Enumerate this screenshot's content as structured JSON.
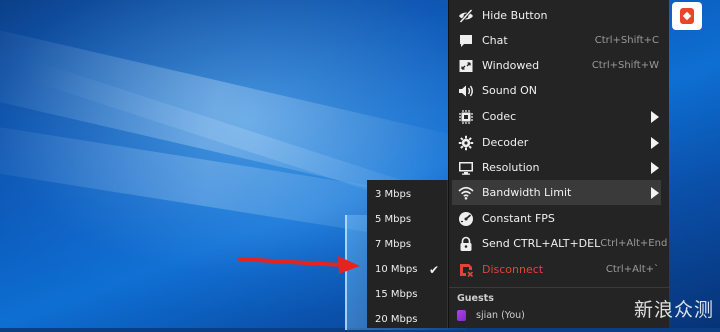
{
  "menu": {
    "items": [
      {
        "label": "Hide Button",
        "shortcut": "",
        "icon": "eye-slash-icon",
        "has_submenu": false
      },
      {
        "label": "Chat",
        "shortcut": "Ctrl+Shift+C",
        "icon": "chat-bubble-icon",
        "has_submenu": false
      },
      {
        "label": "Windowed",
        "shortcut": "Ctrl+Shift+W",
        "icon": "windowed-icon",
        "has_submenu": false
      },
      {
        "label": "Sound ON",
        "shortcut": "",
        "icon": "speaker-icon",
        "has_submenu": false
      },
      {
        "label": "Codec",
        "shortcut": "",
        "icon": "chip-icon",
        "has_submenu": true
      },
      {
        "label": "Decoder",
        "shortcut": "",
        "icon": "gear-icon",
        "has_submenu": true
      },
      {
        "label": "Resolution",
        "shortcut": "",
        "icon": "monitor-icon",
        "has_submenu": true
      },
      {
        "label": "Bandwidth Limit",
        "shortcut": "",
        "icon": "wifi-icon",
        "has_submenu": true,
        "highlighted": true
      },
      {
        "label": "Constant FPS",
        "shortcut": "",
        "icon": "gauge-icon",
        "has_submenu": false
      },
      {
        "label": "Send CTRL+ALT+DEL",
        "shortcut": "Ctrl+Alt+End",
        "icon": "lock-icon",
        "has_submenu": false
      },
      {
        "label": "Disconnect",
        "shortcut": "Ctrl+Alt+`",
        "icon": "disconnect-icon",
        "has_submenu": false,
        "color": "#e0453a"
      }
    ],
    "guests_header": "Guests",
    "guest": {
      "name": "sjian (You)"
    }
  },
  "bandwidth_submenu": {
    "options": [
      {
        "label": "3 Mbps",
        "selected": false
      },
      {
        "label": "5 Mbps",
        "selected": false
      },
      {
        "label": "7 Mbps",
        "selected": false
      },
      {
        "label": "10 Mbps",
        "selected": true
      },
      {
        "label": "15 Mbps",
        "selected": false
      },
      {
        "label": "20 Mbps",
        "selected": false
      }
    ],
    "check_glyph": "✔"
  },
  "colors": {
    "menu_bg": "#242424",
    "highlight_bg": "#3a3a3a",
    "danger": "#e0453a",
    "annotation_arrow": "#e8231f",
    "app_brand": "#e8452d"
  },
  "watermark": "新浪众测"
}
